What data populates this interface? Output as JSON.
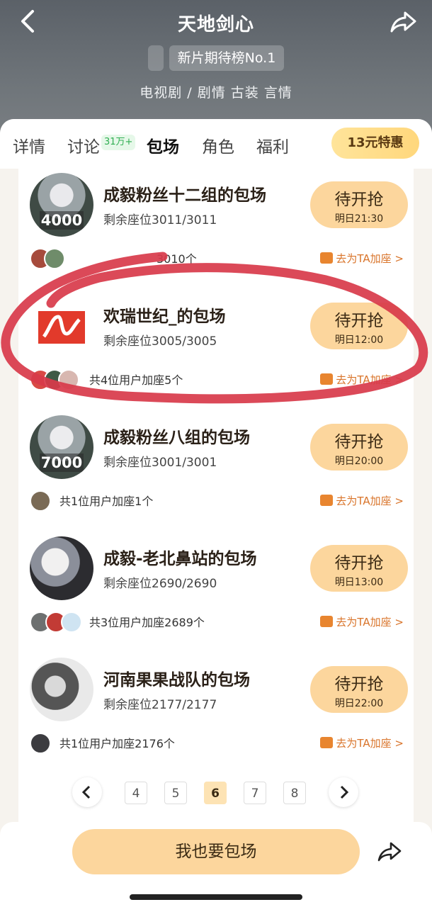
{
  "header": {
    "title": "天地剑心",
    "rank": "新片期待榜No.1",
    "genre": "电视剧 / 剧情 古装 言情"
  },
  "tabs": [
    {
      "label": "详情"
    },
    {
      "label": "讨论",
      "badge": "31万+"
    },
    {
      "label": "包场",
      "active": true
    },
    {
      "label": "角色"
    },
    {
      "label": "福利"
    }
  ],
  "promo": "13元特惠",
  "rows": [
    {
      "title": "成毅粉丝十二组的包场",
      "seats": "剩余座位3011/3011",
      "avatar_num": "4000",
      "button": "待开抢",
      "time": "明日21:30",
      "joined": "3010个",
      "join_link": "去为TA加座 >"
    },
    {
      "title": "欢瑞世纪_的包场",
      "seats": "剩余座位3005/3005",
      "button": "待开抢",
      "time": "明日12:00",
      "joined": "共4位用户加座5个",
      "join_link": "去为TA加座 >"
    },
    {
      "title": "成毅粉丝八组的包场",
      "seats": "剩余座位3001/3001",
      "avatar_num": "7000",
      "button": "待开抢",
      "time": "明日20:00",
      "joined": "共1位用户加座1个",
      "join_link": "去为TA加座 >"
    },
    {
      "title": "成毅-老北鼻站的包场",
      "seats": "剩余座位2690/2690",
      "button": "待开抢",
      "time": "明日13:00",
      "joined": "共3位用户加座2689个",
      "join_link": "去为TA加座 >"
    },
    {
      "title": "河南果果战队的包场",
      "seats": "剩余座位2177/2177",
      "button": "待开抢",
      "time": "明日22:00",
      "joined": "共1位用户加座2176个",
      "join_link": "去为TA加座 >"
    }
  ],
  "pagination": {
    "pages": [
      "4",
      "5",
      "6",
      "7",
      "8"
    ],
    "current": "6"
  },
  "bottom": {
    "button": "我也要包场"
  },
  "colors": {
    "accent": "#fcd69d",
    "link": "#d9742a",
    "annotation": "#d83a4a"
  }
}
